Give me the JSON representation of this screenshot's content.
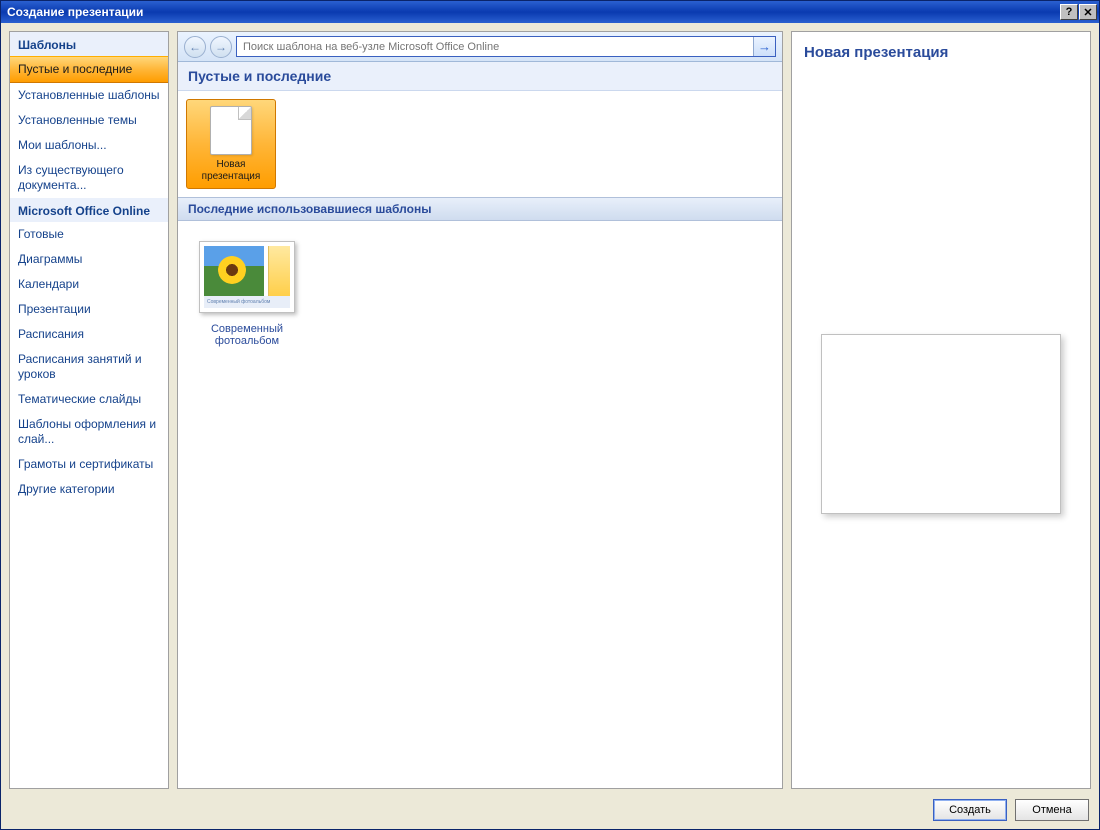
{
  "window": {
    "title": "Создание презентации"
  },
  "sidebar": {
    "header1": "Шаблоны",
    "items1": [
      {
        "label": "Пустые и последние",
        "selected": true
      },
      {
        "label": "Установленные шаблоны"
      },
      {
        "label": "Установленные темы"
      },
      {
        "label": "Мои шаблоны..."
      },
      {
        "label": "Из существующего документа..."
      }
    ],
    "header2": "Microsoft Office Online",
    "items2": [
      {
        "label": "Готовые"
      },
      {
        "label": "Диаграммы"
      },
      {
        "label": "Календари"
      },
      {
        "label": "Презентации"
      },
      {
        "label": "Расписания"
      },
      {
        "label": "Расписания занятий и уроков"
      },
      {
        "label": "Тематические слайды"
      },
      {
        "label": "Шаблоны оформления и слай..."
      },
      {
        "label": "Грамоты и сертификаты"
      },
      {
        "label": "Другие категории"
      }
    ]
  },
  "toolbar": {
    "search_placeholder": "Поиск шаблона на веб-узле Microsoft Office Online"
  },
  "content": {
    "section_title": "Пустые и последние",
    "new_presentation_label": "Новая презентация",
    "recent_header": "Последние использовавшиеся шаблоны",
    "recent_item_label": "Современный фотоальбом",
    "recent_thumb_footer": "Современный фотоальбом"
  },
  "preview": {
    "title": "Новая презентация"
  },
  "buttons": {
    "create": "Создать",
    "cancel": "Отмена"
  }
}
